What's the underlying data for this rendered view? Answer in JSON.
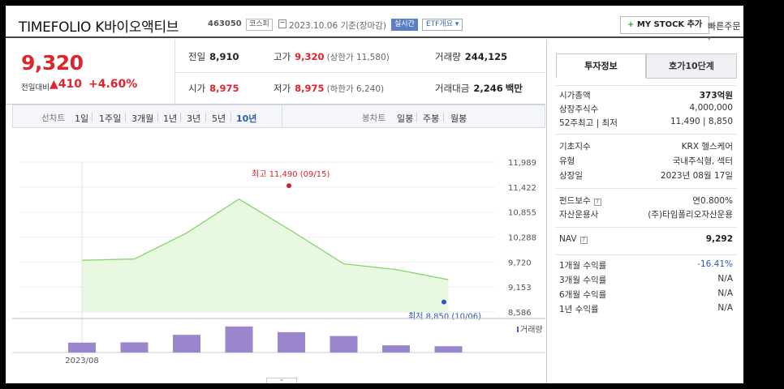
{
  "header": {
    "title": "TIMEFOLIO K바이오액티브",
    "code": "463050",
    "market_badge": "코스피",
    "date": "2023.10.06 기준(장마감)",
    "realtime_label": "실시간",
    "etf_overview": "ETF개요 ▾",
    "my_stock_label": "MY STOCK 추가",
    "quick_order": "빠른주문"
  },
  "price": {
    "current": "9,320",
    "change_label": "전일대비",
    "change": "▲410",
    "change_pct": "+4.60%",
    "prev_close_label": "전일",
    "prev_close": "8,910",
    "high_label": "고가",
    "high": "9,320",
    "upper_limit": "(상한가 11,580)",
    "volume_label": "거래량",
    "volume": "244,125",
    "open_label": "시가",
    "open": "8,975",
    "low_label": "저가",
    "low": "8,975",
    "lower_limit": "(하한가 6,240)",
    "amount_label": "거래대금",
    "amount": "2,246",
    "amount_unit": "백만"
  },
  "range_bar": {
    "line_label": "선차트",
    "ranges": [
      "1일",
      "1주일",
      "3개월",
      "1년",
      "3년",
      "5년",
      "10년"
    ],
    "selected_range": "10년",
    "candle_label": "봉차트",
    "periods": [
      "일봉",
      "주봉",
      "월봉"
    ]
  },
  "chart_data": {
    "type": "area",
    "y_ticks": [
      "11,989",
      "11,422",
      "10,855",
      "10,288",
      "9,720",
      "9,153",
      "8,586"
    ],
    "ylim": [
      8586,
      11989
    ],
    "price_values": [
      9760,
      9790,
      10380,
      11150,
      10430,
      9680,
      9550,
      9320
    ],
    "volume_values": [
      0.33,
      0.34,
      0.59,
      0.87,
      0.68,
      0.55,
      0.24,
      0.21
    ],
    "volume_label": "거래량",
    "x_tick": "2023/08",
    "max_annotation": "최고 11,490 (09/15)",
    "min_annotation": "최저 8,850 (10/06)",
    "colors": {
      "line": "#86d36c",
      "fill": "#e9f8e1",
      "volume": "#9b85cc",
      "annotation": "#d8232a",
      "min_annotation": "#2d59b8"
    }
  },
  "right_panel": {
    "tabs": [
      "투자정보",
      "호가10단계"
    ],
    "rows1": [
      {
        "k": "시가총액",
        "v": "373억원",
        "bold": true
      },
      {
        "k": "상장주식수",
        "v": "4,000,000"
      },
      {
        "k": "52주최고 | 최저",
        "v": "11,490 | 8,850"
      }
    ],
    "rows2": [
      {
        "k": "기초지수",
        "v": "KRX 헬스케어"
      },
      {
        "k": "유형",
        "v": "국내주식형, 섹터"
      },
      {
        "k": "상장일",
        "v": "2023년 08월 17일"
      }
    ],
    "rows3": [
      {
        "k": "펀드보수",
        "v": "연0.800%"
      },
      {
        "k": "자산운용사",
        "v": "(주)타임폴리오자산운용"
      }
    ],
    "nav": {
      "k": "NAV",
      "v": "9,292"
    },
    "returns": [
      {
        "k": "1개월 수익률",
        "v": "-16.41%"
      },
      {
        "k": "3개월 수익률",
        "v": "N/A"
      },
      {
        "k": "6개월 수익률",
        "v": "N/A"
      },
      {
        "k": "1년 수익률",
        "v": "N/A"
      }
    ]
  }
}
